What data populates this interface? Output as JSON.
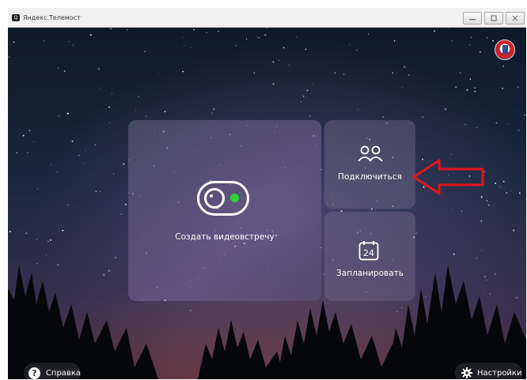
{
  "window": {
    "title": "Яндекс.Телемост",
    "app_icon_text": "Q"
  },
  "main": {
    "create_meeting_label": "Создать видеовстречу",
    "join_label": "Подключиться",
    "plan_label": "Запланировать",
    "calendar_day": "24"
  },
  "footer": {
    "help_label": "Справка",
    "settings_label": "Настройки"
  },
  "icons": {
    "camera": "video-camera-icon",
    "people": "people-icon",
    "calendar": "calendar-icon",
    "help": "help-icon",
    "gear": "gear-icon",
    "arrow": "red-arrow-annotation"
  },
  "colors": {
    "accent_green": "#2bd337",
    "annotation_red": "#e0161c",
    "panel_overlay": "rgba(120,110,140,0.42)"
  }
}
